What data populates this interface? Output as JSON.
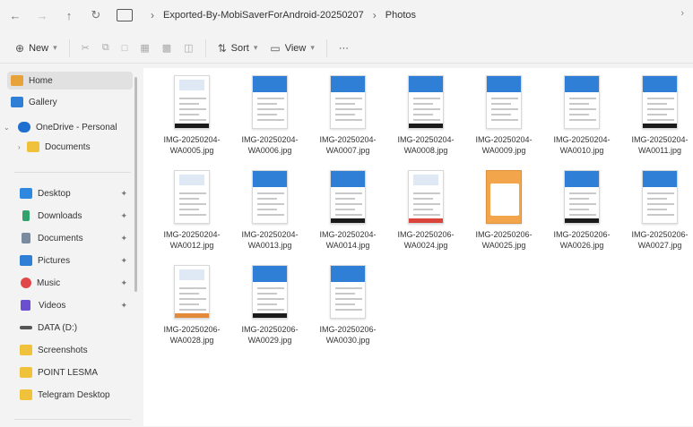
{
  "address_bar": {
    "crumbs": [
      "Exported-By-MobiSaverForAndroid-20250207",
      "Photos"
    ]
  },
  "command_bar": {
    "new_label": "New",
    "sort_label": "Sort",
    "view_label": "View",
    "more_label": "···"
  },
  "sidebar": {
    "items": [
      {
        "label": "Home",
        "icon": "home-icon",
        "color": "#e8a23a"
      },
      {
        "label": "Gallery",
        "icon": "gallery-icon",
        "color": "#2f7fd6"
      },
      {
        "label": "OneDrive - Personal",
        "icon": "cloud-icon",
        "color": "#1e6fd0"
      },
      {
        "label": "Documents",
        "icon": "folder-icon",
        "color": "#f0c23c"
      },
      {
        "label": "Desktop",
        "icon": "desktop-icon",
        "color": "#2f88e0"
      },
      {
        "label": "Downloads",
        "icon": "download-icon",
        "color": "#2fa36b"
      },
      {
        "label": "Documents",
        "icon": "document-icon",
        "color": "#7a8ba0"
      },
      {
        "label": "Pictures",
        "icon": "pictures-icon",
        "color": "#2f7fd6"
      },
      {
        "label": "Music",
        "icon": "music-icon",
        "color": "#e0484a"
      },
      {
        "label": "Videos",
        "icon": "video-icon",
        "color": "#6b4fd0"
      },
      {
        "label": "DATA (D:)",
        "icon": "drive-icon",
        "color": "#555555"
      },
      {
        "label": "Screenshots",
        "icon": "folder-icon",
        "color": "#f0c23c"
      },
      {
        "label": "POINT LESMA",
        "icon": "folder-icon",
        "color": "#f0c23c"
      },
      {
        "label": "Telegram Desktop",
        "icon": "folder-icon",
        "color": "#f0c23c"
      }
    ]
  },
  "files": [
    {
      "line1": "IMG-20250204-",
      "line2": "WA0005.jpg",
      "style": "white"
    },
    {
      "line1": "IMG-20250204-",
      "line2": "WA0006.jpg",
      "style": "blue"
    },
    {
      "line1": "IMG-20250204-",
      "line2": "WA0007.jpg",
      "style": "blue"
    },
    {
      "line1": "IMG-20250204-",
      "line2": "WA0008.jpg",
      "style": "blue"
    },
    {
      "line1": "IMG-20250204-",
      "line2": "WA0009.jpg",
      "style": "blue"
    },
    {
      "line1": "IMG-20250204-",
      "line2": "WA0010.jpg",
      "style": "blue"
    },
    {
      "line1": "IMG-20250204-",
      "line2": "WA0011.jpg",
      "style": "blue"
    },
    {
      "line1": "IMG-20250204-",
      "line2": "WA0012.jpg",
      "style": "white"
    },
    {
      "line1": "IMG-20250204-",
      "line2": "WA0013.jpg",
      "style": "blue"
    },
    {
      "line1": "IMG-20250204-",
      "line2": "WA0014.jpg",
      "style": "blue"
    },
    {
      "line1": "IMG-20250206-",
      "line2": "WA0024.jpg",
      "style": "white-red"
    },
    {
      "line1": "IMG-20250206-",
      "line2": "WA0025.jpg",
      "style": "orange"
    },
    {
      "line1": "IMG-20250206-",
      "line2": "WA0026.jpg",
      "style": "blue"
    },
    {
      "line1": "IMG-20250206-",
      "line2": "WA0027.jpg",
      "style": "blue"
    },
    {
      "line1": "IMG-20250206-",
      "line2": "WA0028.jpg",
      "style": "white-orange"
    },
    {
      "line1": "IMG-20250206-",
      "line2": "WA0029.jpg",
      "style": "blue"
    },
    {
      "line1": "IMG-20250206-",
      "line2": "WA0030.jpg",
      "style": "blue"
    }
  ]
}
